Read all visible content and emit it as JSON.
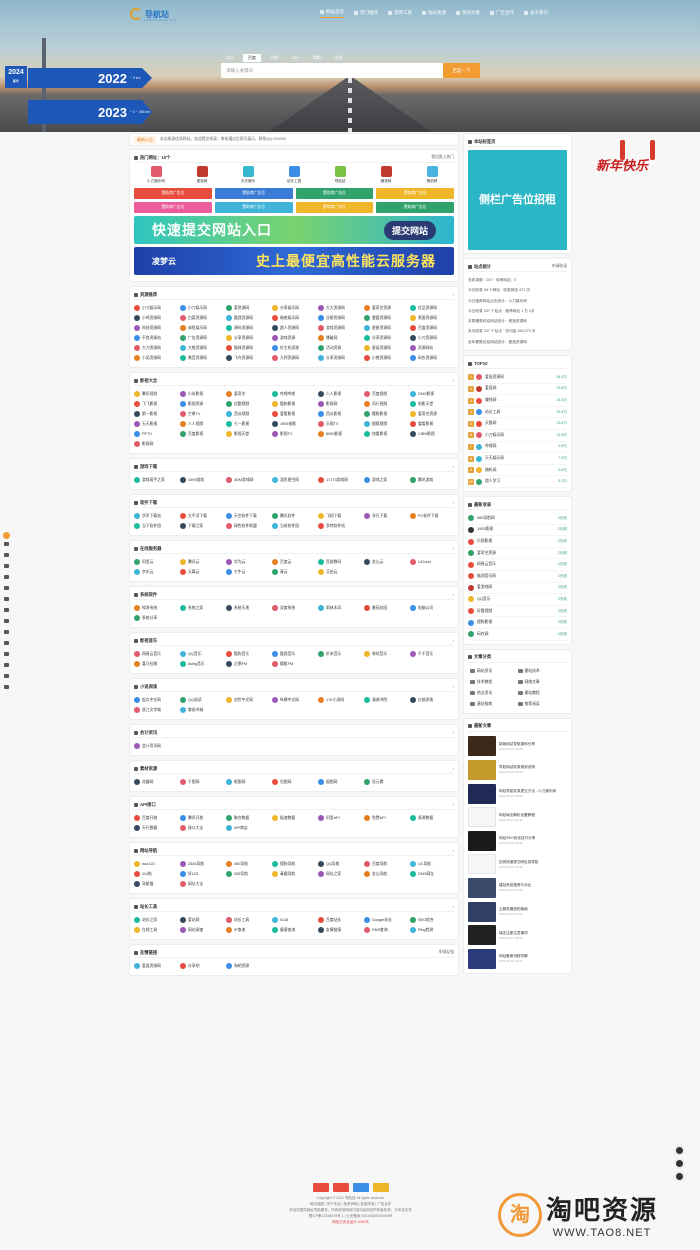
{
  "header": {
    "logo_text": "导航站",
    "logo_sub": "WWW.DAOHANG.COM",
    "nav": [
      {
        "label": "网址首页",
        "active": true
      },
      {
        "label": "热门推荐",
        "active": false
      },
      {
        "label": "常用工具",
        "active": false
      },
      {
        "label": "站长资源",
        "active": false
      },
      {
        "label": "资讯文章",
        "active": false
      },
      {
        "label": "广告合作",
        "active": false
      },
      {
        "label": "关于我们",
        "active": false
      }
    ],
    "search_tabs": [
      "站内",
      "百度",
      "谷歌",
      "360",
      "搜狗",
      "必应"
    ],
    "search_tab_active": 1,
    "search_placeholder": "请输入关键词",
    "search_button": "百度一下",
    "signs": [
      {
        "year": "2022",
        "km": "~ 9 km"
      },
      {
        "year": "2023",
        "km": "~ 0 ~ 365 km"
      }
    ],
    "sign_small": {
      "num": "2024",
      "sub": "新年"
    }
  },
  "notice": {
    "tag": "最新公告",
    "text": "本站收录优质网站，欢迎提交收录，审核通过后即可展示，联系QQ:000000"
  },
  "hot": {
    "title": "热门网址：10个",
    "more": "我也要上热门",
    "items": [
      {
        "label": "小刀娱乐网",
        "color": "#e05a6b"
      },
      {
        "label": "爱逛网",
        "color": "#c0392b"
      },
      {
        "label": "天天娱乐",
        "color": "#35b8d0"
      },
      {
        "label": "站长工具",
        "color": "#3a8ee6"
      },
      {
        "label": "导航站",
        "color": "#7cc243"
      },
      {
        "label": "赚钱网",
        "color": "#c0392b"
      },
      {
        "label": "随机网",
        "color": "#4ab3e0"
      }
    ]
  },
  "ads": [
    {
      "label": "赞助商广告位",
      "color": "#e74c3c"
    },
    {
      "label": "赞助商广告位",
      "color": "#3a7bd5"
    },
    {
      "label": "赞助商广告位",
      "color": "#2fa36b"
    },
    {
      "label": "赞助商广告位",
      "color": "#f0b62a"
    },
    {
      "label": "赞助商广告位",
      "color": "#ec5c9a"
    },
    {
      "label": "赞助商广告位",
      "color": "#3fb4d8"
    },
    {
      "label": "赞助商广告位",
      "color": "#f0b62a"
    },
    {
      "label": "赞助商广告位",
      "color": "#2fa36b"
    }
  ],
  "banners": [
    {
      "text": "快速提交网站入口",
      "button": "提交网站",
      "bg": "linear-gradient(90deg,#2ec6c1,#7ad36d,#2cb5d0)"
    },
    {
      "text": "史上最便宜高性能云服务器",
      "button": "凌梦云",
      "bg": "linear-gradient(90deg,#1e3fa8,#2f6ad6,#1e3fa8)"
    }
  ],
  "sections": [
    {
      "title": "资源推荐",
      "links": [
        "小刀娱乐网",
        "小刀娱乐网",
        "爱资源网",
        "分享娱乐网",
        "大大资源网",
        "爱奇艺资源",
        "优品资源网",
        "小鸡资源网",
        "白菜资源网",
        "酷我资源网",
        "暗夜娱乐网",
        "谷歌资源网",
        "雷霆资源网",
        "黑客资源网",
        "科技资源网",
        "咸鱼娱乐网",
        "源码资源网",
        "超人资源网",
        "游戏资源网",
        "星星资源网",
        "百度资源网",
        "不良资源站",
        "广告资源网",
        "分享资源网",
        "游戏资源",
        "爆破网",
        "分享资源网",
        "小刀资源网",
        "大刀资源网",
        "大橙资源网",
        "猫咪资源网",
        "好主机资源",
        "活动资源",
        "星辰资源网",
        "资源网站",
        "小吴资源网",
        "美音资源网",
        "飞鸟资源网",
        "大师资源网",
        "分享资源网",
        "小猪资源网",
        "码农资源网"
      ]
    },
    {
      "title": "影视大全",
      "links": [
        "腾讯视频",
        "小米影视",
        "爱奇艺",
        "哔哩哔哩",
        "人人影视",
        "百度视频",
        "2345影视",
        "飞飞影视",
        "影视资源",
        "优酷视频",
        "酷狗影视",
        "影视网",
        "风行视频",
        "电影天堂",
        "第一影视",
        "芒果TV",
        "西瓜视频",
        "爱看影视",
        "西瓜影视",
        "樱桃影视",
        "爱奇艺资源",
        "天天影视",
        "人人视频",
        "七一影视",
        "1905电影",
        "乐视TV",
        "搜狐视频",
        "看看影视",
        "PPTV",
        "百度影视",
        "影视天堂",
        "影视TV",
        "8090影视",
        "快看影视",
        "CIBN影视",
        "影视网"
      ]
    },
    {
      "title": "游戏下载",
      "links": [
        "游戏高手之家",
        "4399游戏",
        "3DM游戏网",
        "游民星空网",
        "17173游戏网",
        "游戏之家",
        "腾讯游戏"
      ]
    },
    {
      "title": "软件下载",
      "links": [
        "华军下载站",
        "太平洋下载",
        "天空软件下载",
        "腾讯软件",
        "飞翔下载",
        "非凡下载",
        "PC软件下载",
        "当下软件园",
        "下载之家",
        "绿色软件联盟",
        "当易软件园",
        "多特软件站"
      ]
    },
    {
      "title": "在线服务器",
      "links": [
        "阿里云",
        "腾讯云",
        "华为云",
        "百度云",
        "西部数码",
        "金山云",
        "UCloud",
        "京东云",
        "天翼云",
        "七牛云",
        "青云",
        "又拍云"
      ]
    },
    {
      "title": "系统软件",
      "links": [
        "纯净系统",
        "系统之家",
        "系统天地",
        "深度系统",
        "雨林木风",
        "番茄花园",
        "电脑公司",
        "系统分享"
      ]
    },
    {
      "title": "影视音乐",
      "links": [
        "网易云音乐",
        "QQ音乐",
        "酷狗音乐",
        "酷我音乐",
        "虾米音乐",
        "咪咕音乐",
        "千千音乐",
        "喜马拉雅",
        "5sing音乐",
        "企鹅FM",
        "蜻蜓FM"
      ]
    },
    {
      "title": "小说阅读",
      "links": [
        "起点中文网",
        "QQ阅读",
        "创世中文网",
        "纵横中文网",
        "17K小说网",
        "潇湘书院",
        "红袖添香",
        "晋江文学城",
        "掌阅书城"
      ]
    },
    {
      "title": "会计资讯",
      "links": [
        "会计资讯网"
      ]
    },
    {
      "title": "素材资源",
      "links": [
        "花瓣网",
        "千图网",
        "昵图网",
        "包图网",
        "摄图网",
        "觅元素"
      ]
    },
    {
      "title": "API接口",
      "links": [
        "百度开放",
        "腾讯开放",
        "聚合数据",
        "极速数据",
        "阿里API",
        "免费API",
        "易源数据",
        "天行数据",
        "接口大全",
        "API商店"
      ]
    },
    {
      "title": "网站导航",
      "links": [
        "hao123",
        "2345导航",
        "360导航",
        "搜狗导航",
        "QQ导航",
        "百度导航",
        "UC导航",
        "114啦",
        "好123",
        "265导航",
        "毒霸导航",
        "网址之家",
        "金山导航",
        "2345网址",
        "导航猫",
        "网址大全"
      ]
    },
    {
      "title": "站长工具",
      "links": [
        "站长之家",
        "爱站网",
        "站长工具",
        "5118",
        "百度站长",
        "Google站长",
        "SEO综合",
        "在线工具",
        "网站测速",
        "IP查询",
        "备案查询",
        "友情链接",
        "DNS查询",
        "Ping检测"
      ]
    },
    {
      "title": "友情链接",
      "more": "申请友链",
      "links": [
        "爱逛资源网",
        "分享吧",
        "淘吧资源"
      ]
    }
  ],
  "side_ad": {
    "text": "侧栏广告位招租",
    "header": "本站标签页"
  },
  "stats": {
    "title": "站点统计",
    "more": "申请收录",
    "rows": [
      "总收录数：207 · 待审网站：0",
      "今日收录 98 个网站 · 收录网站 471 次",
      "今日推荐网站点击统计：小刀娱乐网",
      "今日收录 207 个站点 · 推荐网站 1 万 1次",
      "本周最受欢迎网站统计：爱逛资源网",
      "本月收录 207 个站点 · 访问量 156,379 次",
      "全年最受欢迎网站统计：爱逛资源网"
    ]
  },
  "top": {
    "title": "TOP10",
    "items": [
      {
        "label": "爱逛资源网",
        "value": "54.8万",
        "color": "#e05a6b"
      },
      {
        "label": "爱逛网",
        "value": "23.8万",
        "color": "#c0392b"
      },
      {
        "label": "赚钱网",
        "value": "16.4万",
        "color": "#e74c3c"
      },
      {
        "label": "站长工具",
        "value": "15.4万",
        "color": "#3a8ee6"
      },
      {
        "label": "天猫网",
        "value": "13.6万",
        "color": "#e74c3c"
      },
      {
        "label": "小刀娱乐网",
        "value": "11.8万",
        "color": "#e05a6b"
      },
      {
        "label": "哔哩网",
        "value": "9.8万",
        "color": "#3fb4d8"
      },
      {
        "label": "天天娱乐网",
        "value": "7.8万",
        "color": "#35b8d0"
      },
      {
        "label": "随机网",
        "value": "6.6万",
        "color": "#f0b62a"
      },
      {
        "label": "超人学习",
        "value": "5.3万",
        "color": "#2fa36b"
      }
    ]
  },
  "latest": {
    "title": "最新收录",
    "items": [
      {
        "label": "360导航网",
        "value": "2天前",
        "color": "#2fa36b"
      },
      {
        "label": "1905影视",
        "value": "2天前",
        "color": "#333"
      },
      {
        "label": "乐视影视",
        "value": "2天前",
        "color": "#e74c3c"
      },
      {
        "label": "爱奇艺资源",
        "value": "2天前",
        "color": "#2fa36b"
      },
      {
        "label": "网易云音乐",
        "value": "2天前",
        "color": "#e74c3c"
      },
      {
        "label": "脑洞音乐网",
        "value": "2天前",
        "color": "#e74c3c"
      },
      {
        "label": "爱游戏网",
        "value": "2天前",
        "color": "#c0392b"
      },
      {
        "label": "QQ音乐",
        "value": "2天前",
        "color": "#f0b62a"
      },
      {
        "label": "好看视频",
        "value": "2天前",
        "color": "#e74c3c"
      },
      {
        "label": "搜狗影视",
        "value": "2天前",
        "color": "#3a8ee6"
      },
      {
        "label": "码农网",
        "value": "2天前",
        "color": "#2fa36b"
      }
    ]
  },
  "tagcloud": {
    "title": "文章分类",
    "items": [
      "网站资讯",
      "建站技术",
      "技术教程",
      "网络文章",
      "热点资讯",
      "建站教程",
      "建站指南",
      "推荐阅读"
    ]
  },
  "articles": {
    "title": "最新文章",
    "items": [
      {
        "title": "新版网站导航源码分享",
        "meta": "2021-05-15 10:25",
        "color": "#3b2a1a"
      },
      {
        "title": "导航网站收录规则说明",
        "meta": "2021-05-15 10:20",
        "color": "#c49a2a"
      },
      {
        "title": "网站导航收录提交方法 - 小刀娱乐网",
        "meta": "2021-05-14 18:02",
        "color": "#1f2a55"
      },
      {
        "title": "网站域名解析设置教程",
        "meta": "2021-05-14 12:11",
        "color": "#f6f6f6"
      },
      {
        "title": "网站SEO优化技巧分享",
        "meta": "2021-05-13 09:45",
        "color": "#1a1a1a"
      },
      {
        "title": "如何快速提交网址到导航",
        "meta": "2021-05-12 16:30",
        "color": "#f6f6f6"
      },
      {
        "title": "建站系统推荐与对比",
        "meta": "2021-05-12 11:08",
        "color": "#3a4a6a"
      },
      {
        "title": "云服务器选购指南",
        "meta": "2021-05-11 19:22",
        "color": "#2f3f66"
      },
      {
        "title": "域名注册注意事项",
        "meta": "2021-05-11 08:50",
        "color": "#222"
      },
      {
        "title": "网站备案流程详解",
        "meta": "2021-05-10 14:17",
        "color": "#2a3a7a"
      }
    ]
  },
  "footer": {
    "logo_colors": [
      "#e74c3c",
      "#e74c3c",
      "#3a8ee6",
      "#f0b62a"
    ],
    "lines": [
      "Copyright © 2021 导航站 All rights reserved",
      "网站地图 | 关于本站 | 免责声明 | 友链申请 | 广告合作",
      "本站仅提供网址导航服务，所有收录网站内容均由网站所有者负责，与本站无关",
      "蜀ICP备12345678号-1 | 公安备案 51010000000000号"
    ],
    "red_line": "网站已安全运行 1000天"
  },
  "watermark": {
    "glyph": "淘",
    "title": "淘吧资源",
    "url": "WWW.TAO8.NET"
  },
  "couplet_text": "新年快乐"
}
